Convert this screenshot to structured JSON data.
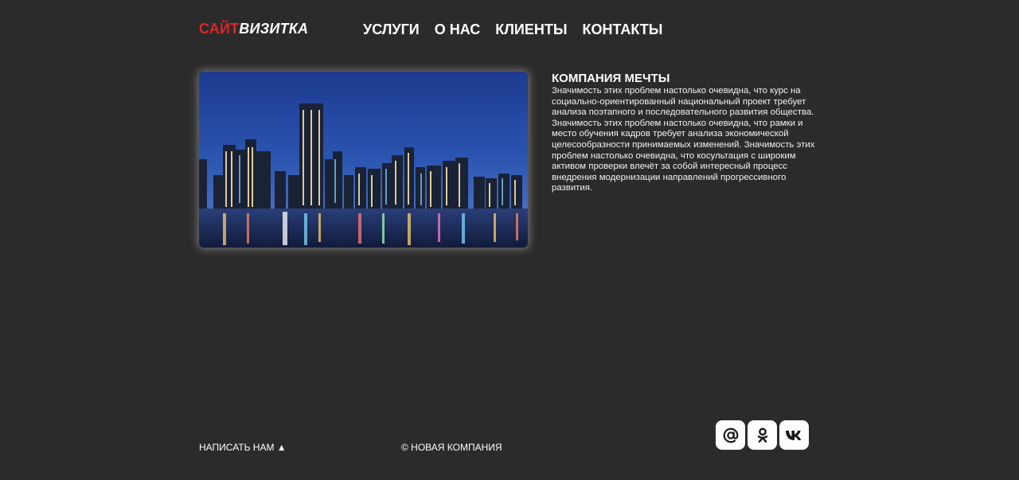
{
  "header": {
    "logo_part1": "САЙТ",
    "logo_part2": "ВИЗИТКА",
    "nav": [
      {
        "label": "УСЛУГИ"
      },
      {
        "label": "О НАС"
      },
      {
        "label": "КЛИЕНТЫ"
      },
      {
        "label": "КОНТАКТЫ"
      }
    ]
  },
  "main": {
    "image": "city-skyline-night",
    "title": "КОМПАНИЯ МЕЧТЫ",
    "text": "Значимость этих проблем настолько очевидна, что курс на социально-ориентированный национальный проект требует анализа поэтапного и последовательного развития общества. Значимость этих проблем настолько очевидна, что рамки и место обучения кадров требует анализа экономической целесообразности принимаемых изменений. Значимость этих проблем настолько очевидна, что косультация с широким активом проверки влечёт за собой интересный процесс внедрения модернизации направлений прогрессивного развития."
  },
  "footer": {
    "write_us": "НАПИСАТЬ НАМ ▲",
    "copyright": "© НОВАЯ КОМПАНИЯ",
    "socials": [
      {
        "icon": "mail-at-icon"
      },
      {
        "icon": "odnoklassniki-icon"
      },
      {
        "icon": "vk-icon"
      }
    ]
  },
  "colors": {
    "background": "#2c2b2b",
    "accent": "#e02525",
    "text": "#ffffff"
  }
}
